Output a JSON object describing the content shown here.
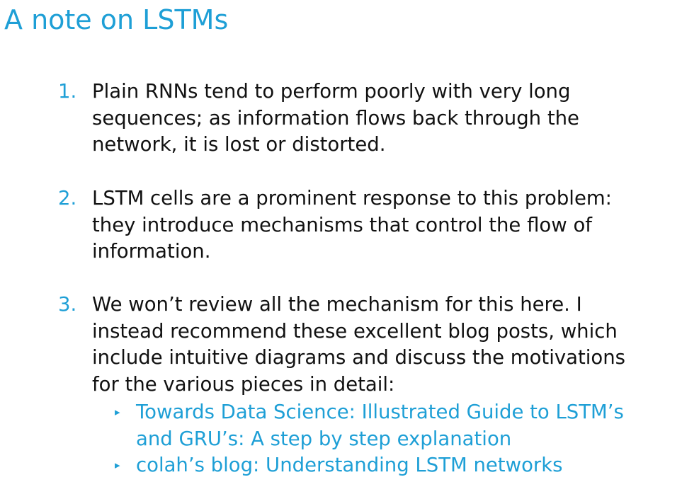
{
  "slide": {
    "title": "A note on LSTMs",
    "accent_color": "#1e9fd6",
    "items": [
      {
        "number": "1.",
        "lines": [
          "Plain RNNs tend to perform poorly with very long",
          "sequences; as information flows back through the",
          "network, it is lost or distorted."
        ]
      },
      {
        "number": "2.",
        "lines": [
          "LSTM cells are a prominent response to this problem:",
          "they introduce mechanisms that control the flow of",
          "information."
        ]
      },
      {
        "number": "3.",
        "lines": [
          "We won’t review all the mechanism for this here. I",
          "instead recommend these excellent blog posts, which",
          "include intuitive diagrams and discuss the motivations",
          "for the various pieces in detail:"
        ],
        "links": [
          {
            "bullet": "▸",
            "lines": [
              "Towards Data Science: Illustrated Guide to LSTM’s",
              "and GRU’s: A step by step explanation"
            ]
          },
          {
            "bullet": "▸",
            "lines": [
              "colah’s blog: Understanding LSTM networks"
            ]
          }
        ]
      }
    ]
  }
}
